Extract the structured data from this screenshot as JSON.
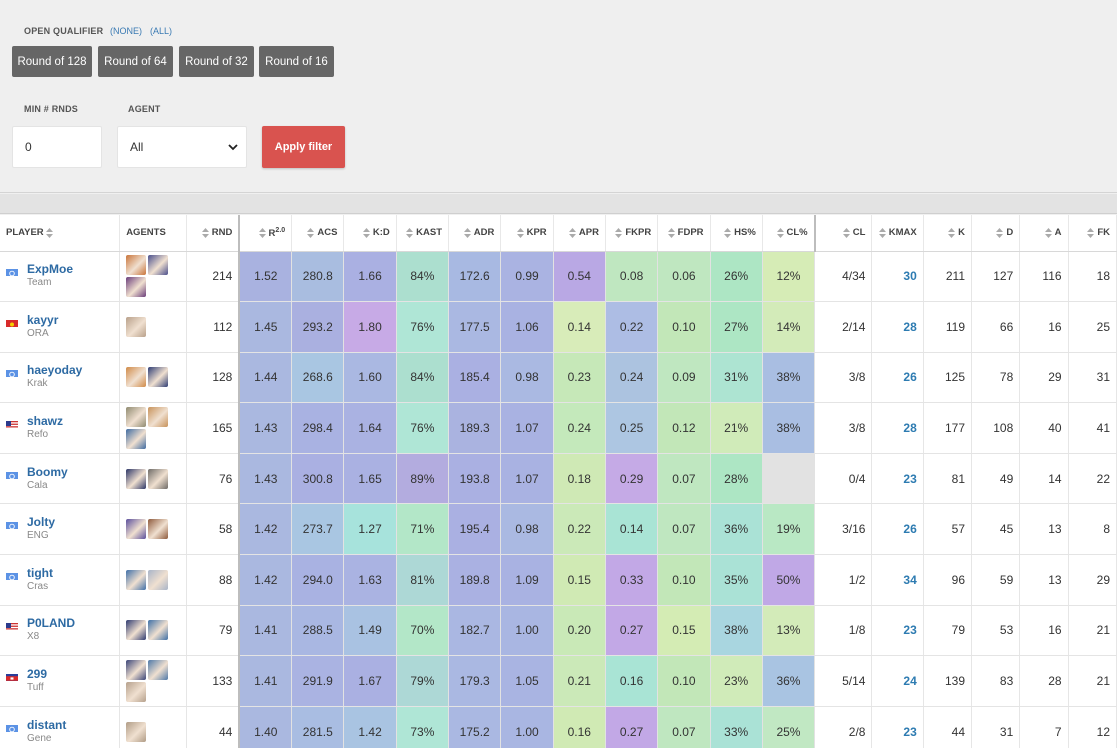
{
  "filters": {
    "open_qualifier_label": "OPEN QUALIFIER",
    "none_link": "(NONE)",
    "all_link": "(ALL)",
    "rounds": [
      "Round of 128",
      "Round of 64",
      "Round of 32",
      "Round of 16"
    ],
    "min_rnds_label": "MIN # RNDS",
    "min_rnds_value": "0",
    "agent_label": "AGENT",
    "agent_value": "All",
    "apply_label": "Apply filter"
  },
  "table": {
    "headers": [
      "PLAYER",
      "AGENTS",
      "RND",
      "R",
      "ACS",
      "K:D",
      "KAST",
      "ADR",
      "KPR",
      "APR",
      "FKPR",
      "FDPR",
      "HS%",
      "CL%",
      "CL",
      "KMAX",
      "K",
      "D",
      "A",
      "FK"
    ],
    "rating_superscript": "2.0",
    "rows": [
      {
        "name": "ExpMoe",
        "team": "Team",
        "flag": "un",
        "agents": [
          "#c9743a",
          "#4a4f8c",
          "#6a3d7a"
        ],
        "rnd": "214",
        "stats": [
          "1.52",
          "280.8",
          "1.66",
          "84%",
          "172.6",
          "0.99",
          "0.54",
          "0.08",
          "0.06",
          "26%",
          "12%"
        ],
        "cl": "4/34",
        "kmax": "30",
        "k": "211",
        "d": "127",
        "a": "116",
        "fk": "18"
      },
      {
        "name": "kayyr",
        "team": "ORA",
        "flag": "kg",
        "agents": [
          "#b8a08a"
        ],
        "rnd": "112",
        "stats": [
          "1.45",
          "293.2",
          "1.80",
          "76%",
          "177.5",
          "1.06",
          "0.14",
          "0.22",
          "0.10",
          "27%",
          "14%"
        ],
        "cl": "2/14",
        "kmax": "28",
        "k": "119",
        "d": "66",
        "a": "16",
        "fk": "25"
      },
      {
        "name": "haeyoday",
        "team": "Krak",
        "flag": "un",
        "agents": [
          "#d08a48",
          "#2e3d74"
        ],
        "rnd": "128",
        "stats": [
          "1.44",
          "268.6",
          "1.60",
          "84%",
          "185.4",
          "0.98",
          "0.23",
          "0.24",
          "0.09",
          "31%",
          "38%"
        ],
        "cl": "3/8",
        "kmax": "26",
        "k": "125",
        "d": "78",
        "a": "29",
        "fk": "31"
      },
      {
        "name": "shawz",
        "team": "Refo",
        "flag": "us",
        "agents": [
          "#8f8a70",
          "#c7925a",
          "#3e6aa0"
        ],
        "rnd": "165",
        "stats": [
          "1.43",
          "298.4",
          "1.64",
          "76%",
          "189.3",
          "1.07",
          "0.24",
          "0.25",
          "0.12",
          "21%",
          "38%"
        ],
        "cl": "3/8",
        "kmax": "28",
        "k": "177",
        "d": "108",
        "a": "40",
        "fk": "41"
      },
      {
        "name": "Boomy",
        "team": "Cala",
        "flag": "un",
        "agents": [
          "#2b3566",
          "#6d6a66"
        ],
        "rnd": "76",
        "stats": [
          "1.43",
          "300.8",
          "1.65",
          "89%",
          "193.8",
          "1.07",
          "0.18",
          "0.29",
          "0.07",
          "28%",
          ""
        ],
        "cl": "0/4",
        "kmax": "23",
        "k": "81",
        "d": "49",
        "a": "14",
        "fk": "22"
      },
      {
        "name": "Jolty",
        "team": "ENG",
        "flag": "un",
        "agents": [
          "#5a4e9c",
          "#8e5a3c"
        ],
        "rnd": "58",
        "stats": [
          "1.42",
          "273.7",
          "1.27",
          "71%",
          "195.4",
          "0.98",
          "0.22",
          "0.14",
          "0.07",
          "36%",
          "19%"
        ],
        "cl": "3/16",
        "kmax": "26",
        "k": "57",
        "d": "45",
        "a": "13",
        "fk": "8"
      },
      {
        "name": "tight",
        "team": "Cras",
        "flag": "un",
        "agents": [
          "#3f6fa8",
          "#a8b4c8"
        ],
        "rnd": "88",
        "stats": [
          "1.42",
          "294.0",
          "1.63",
          "81%",
          "189.8",
          "1.09",
          "0.15",
          "0.33",
          "0.10",
          "35%",
          "50%"
        ],
        "cl": "1/2",
        "kmax": "34",
        "k": "96",
        "d": "59",
        "a": "13",
        "fk": "29"
      },
      {
        "name": "P0LAND",
        "team": "X8",
        "flag": "us",
        "agents": [
          "#2e3a70",
          "#3d6fa6"
        ],
        "rnd": "79",
        "stats": [
          "1.41",
          "288.5",
          "1.49",
          "70%",
          "182.7",
          "1.00",
          "0.20",
          "0.27",
          "0.15",
          "38%",
          "13%"
        ],
        "cl": "1/8",
        "kmax": "23",
        "k": "79",
        "d": "53",
        "a": "16",
        "fk": "21"
      },
      {
        "name": "299",
        "team": "Tuff",
        "flag": "kh",
        "agents": [
          "#3a4478",
          "#4e78a8",
          "#b5a08c"
        ],
        "rnd": "133",
        "stats": [
          "1.41",
          "291.9",
          "1.67",
          "79%",
          "179.3",
          "1.05",
          "0.21",
          "0.16",
          "0.10",
          "23%",
          "36%"
        ],
        "cl": "5/14",
        "kmax": "24",
        "k": "139",
        "d": "83",
        "a": "28",
        "fk": "21"
      },
      {
        "name": "distant",
        "team": "Gene",
        "flag": "un",
        "agents": [
          "#b09c86"
        ],
        "rnd": "44",
        "stats": [
          "1.40",
          "281.5",
          "1.42",
          "73%",
          "175.2",
          "1.00",
          "0.16",
          "0.27",
          "0.07",
          "33%",
          "25%"
        ],
        "cl": "2/8",
        "kmax": "23",
        "k": "44",
        "d": "31",
        "a": "7",
        "fk": "12"
      }
    ],
    "stat_colors": [
      [
        "#a9b2e0",
        "#a9bde0",
        "#aab0e2",
        "#acdfcf",
        "#a8b9e2",
        "#aab3e2",
        "#b9a8e4",
        "#bfe7c0",
        "#bfe7c0",
        "#ade6c4",
        "#d6ecb6"
      ],
      [
        "#aab8e0",
        "#aab0e0",
        "#c7aae6",
        "#afe6d6",
        "#aab8e2",
        "#a9b2e2",
        "#d8ecb9",
        "#adbde4",
        "#c2e7b8",
        "#ade6c4",
        "#d3ebb9"
      ],
      [
        "#aab8e0",
        "#a9c6e2",
        "#aab8e2",
        "#acdfcf",
        "#aab0e2",
        "#aab9e2",
        "#c6e8b8",
        "#acc3e0",
        "#bfe7c0",
        "#ade4d2",
        "#a9bee2"
      ],
      [
        "#aab8e0",
        "#a9b2e2",
        "#aab2e2",
        "#afe6d6",
        "#aab3e0",
        "#a9b2e2",
        "#c4e9bb",
        "#adc6e2",
        "#c2e7b8",
        "#d0ebb9",
        "#a9bee2"
      ],
      [
        "#aab8e0",
        "#aab0e2",
        "#aab1e2",
        "#b3acdf",
        "#aab0e2",
        "#a9b2e2",
        "#cfe9b5",
        "#c5aae6",
        "#bfe7c0",
        "#ade6c4",
        "#e2e2e2"
      ],
      [
        "#aab8e0",
        "#a9c6e2",
        "#a7e3dc",
        "#b3e7c8",
        "#aab0e2",
        "#aab9e2",
        "#cbe9b8",
        "#a9e4d5",
        "#bfe7c0",
        "#aae2d6",
        "#b9e8c4"
      ],
      [
        "#aab8e0",
        "#a9b2e2",
        "#aab3e2",
        "#add8d6",
        "#aab1e2",
        "#a9b2e2",
        "#d0eab4",
        "#c2a8e6",
        "#c2e7b8",
        "#aae2d6",
        "#c0a8e6"
      ],
      [
        "#aab8e0",
        "#a9b7e2",
        "#a9c2e2",
        "#b3e7c8",
        "#aab7e2",
        "#a9b6e2",
        "#c9e9b7",
        "#c2a8e6",
        "#d4ecb4",
        "#a9d6e0",
        "#d3ebb9"
      ],
      [
        "#aab8e0",
        "#aab3e2",
        "#aab0e2",
        "#add8d6",
        "#aab8e2",
        "#a9b4e2",
        "#cbe9b8",
        "#a9e4d5",
        "#c2e7b8",
        "#d0ebb9",
        "#a9c4e2"
      ],
      [
        "#aab8e0",
        "#a9bde2",
        "#a9c4e2",
        "#afe6d6",
        "#aab8e2",
        "#a9b6e2",
        "#d0eab4",
        "#c2a8e6",
        "#bfe7c0",
        "#aae2d6",
        "#c1e8c3"
      ]
    ]
  }
}
